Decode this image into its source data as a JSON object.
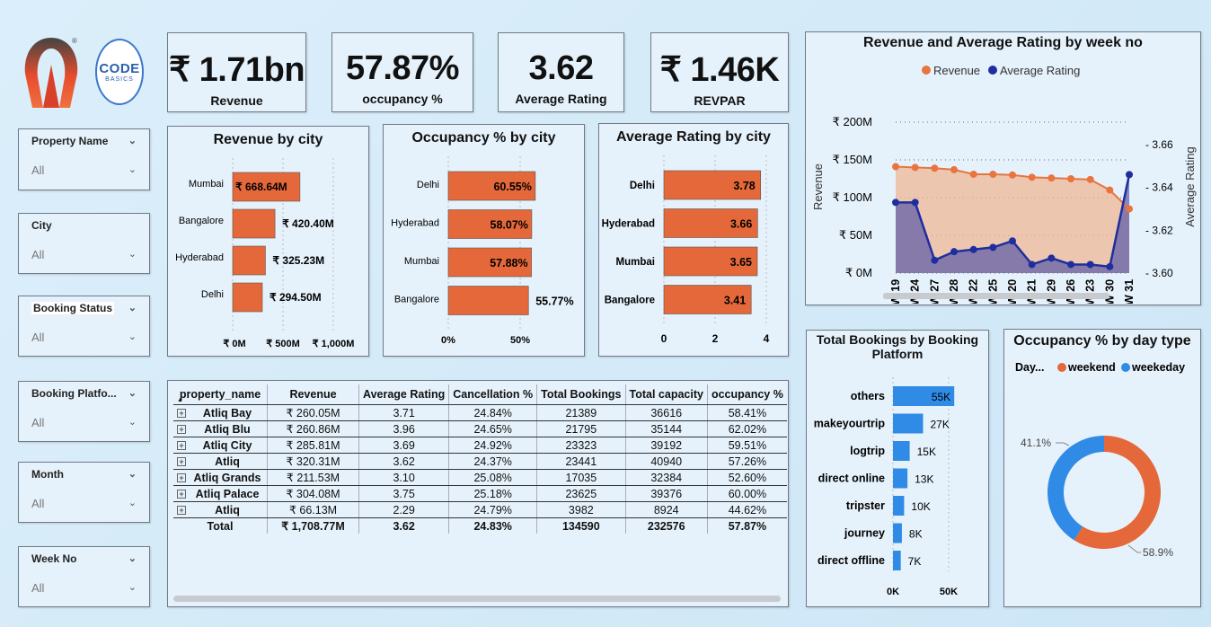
{
  "logos": {
    "code_main": "CODE",
    "code_sub": "BASICS",
    "registered": "®"
  },
  "kpis": [
    {
      "value": "₹ 1.71bn",
      "label": "Revenue"
    },
    {
      "value": "57.87%",
      "label": "occupancy %"
    },
    {
      "value": "3.62",
      "label": "Average Rating"
    },
    {
      "value": "₹ 1.46K",
      "label": "REVPAR"
    }
  ],
  "slicers": [
    {
      "title": "Property Name",
      "value": "All"
    },
    {
      "title": "City",
      "value": "All"
    },
    {
      "title": "Booking Status",
      "value": "All"
    },
    {
      "title": "Booking Platfo...",
      "value": "All"
    },
    {
      "title": "Month",
      "value": "All"
    },
    {
      "title": "Week No",
      "value": "All"
    }
  ],
  "revenue_by_city": {
    "title": "Revenue by city",
    "labels": [
      "Mumbai",
      "Bangalore",
      "Hyderabad",
      "Delhi"
    ],
    "values": [
      668.64,
      420.4,
      325.23,
      294.5
    ],
    "data_labels": [
      "₹ 668.64M",
      "₹ 420.40M",
      "₹ 325.23M",
      "₹ 294.50M"
    ],
    "ticks": [
      "₹ 0M",
      "₹ 500M",
      "₹ 1,000M"
    ]
  },
  "occupancy_by_city": {
    "title": "Occupancy % by city",
    "labels": [
      "Delhi",
      "Hyderabad",
      "Mumbai",
      "Bangalore"
    ],
    "values": [
      60.55,
      58.07,
      57.88,
      55.77
    ],
    "data_labels": [
      "60.55%",
      "58.07%",
      "57.88%",
      "55.77%"
    ],
    "ticks": [
      "0%",
      "50%"
    ]
  },
  "rating_by_city": {
    "title": "Average Rating by city",
    "labels": [
      "Delhi",
      "Hyderabad",
      "Mumbai",
      "Bangalore"
    ],
    "values": [
      3.78,
      3.66,
      3.65,
      3.41
    ],
    "data_labels": [
      "3.78",
      "3.66",
      "3.65",
      "3.41"
    ],
    "ticks": [
      "0",
      "2",
      "4"
    ]
  },
  "chart_data": [
    {
      "type": "area",
      "title": "Revenue and Average Rating by week no",
      "legend": [
        "Revenue",
        "Average Rating"
      ],
      "legend_position": "top",
      "ylabel": "Revenue",
      "y2label": "Average Rating",
      "categories": [
        "W 19",
        "W 24",
        "W 27",
        "W 28",
        "W 22",
        "W 25",
        "W 20",
        "W 21",
        "W 29",
        "W 26",
        "W 23",
        "W 30",
        "W 31"
      ],
      "series": [
        {
          "name": "Revenue",
          "axis": "left",
          "values": [
            141,
            140,
            139,
            137,
            131,
            131,
            130,
            127,
            126,
            125,
            124,
            110,
            85
          ]
        },
        {
          "name": "Average Rating",
          "axis": "right",
          "values": [
            3.633,
            3.633,
            3.606,
            3.61,
            3.611,
            3.612,
            3.615,
            3.604,
            3.607,
            3.604,
            3.604,
            3.603,
            3.646
          ]
        }
      ],
      "y_ticks": [
        "₹ 0M",
        "₹ 50M",
        "₹ 100M",
        "₹ 150M",
        "₹ 200M"
      ],
      "y2_ticks": [
        "3.60",
        "3.62",
        "3.64",
        "3.66"
      ],
      "ylim": [
        0,
        200
      ],
      "y2lim": [
        3.6,
        3.66
      ]
    },
    {
      "type": "bar",
      "title": "Total Bookings by Booking Platform",
      "categories": [
        "others",
        "makeyourtrip",
        "logtrip",
        "direct online",
        "tripster",
        "journey",
        "direct offline"
      ],
      "values": [
        55,
        27,
        15,
        13,
        10,
        8,
        7
      ],
      "data_labels": [
        "55K",
        "27K",
        "15K",
        "13K",
        "10K",
        "8K",
        "7K"
      ],
      "ticks": [
        "0K",
        "50K"
      ],
      "xlim": [
        0,
        60
      ]
    },
    {
      "type": "pie",
      "title": "Occupancy % by day type",
      "legend_title": "Day...",
      "categories": [
        "weekend",
        "weekeday"
      ],
      "values": [
        58.9,
        41.1
      ],
      "data_labels": [
        "58.9%",
        "41.1%"
      ]
    }
  ],
  "table": {
    "headers": [
      "property_name",
      "Revenue",
      "Average Rating",
      "Cancellation %",
      "Total Bookings",
      "Total capacity",
      "occupancy %"
    ],
    "rows": [
      [
        "Atliq Bay",
        "₹ 260.05M",
        "3.71",
        "24.84%",
        "21389",
        "36616",
        "58.41%"
      ],
      [
        "Atliq Blu",
        "₹ 260.86M",
        "3.96",
        "24.65%",
        "21795",
        "35144",
        "62.02%"
      ],
      [
        "Atliq City",
        "₹ 285.81M",
        "3.69",
        "24.92%",
        "23323",
        "39192",
        "59.51%"
      ],
      [
        "Atliq",
        "₹ 320.31M",
        "3.62",
        "24.37%",
        "23441",
        "40940",
        "57.26%"
      ],
      [
        "Atliq Grands",
        "₹ 211.53M",
        "3.10",
        "25.08%",
        "17035",
        "32384",
        "52.60%"
      ],
      [
        "Atliq Palace",
        "₹ 304.08M",
        "3.75",
        "25.18%",
        "23625",
        "39376",
        "60.00%"
      ],
      [
        "Atliq",
        "₹ 66.13M",
        "2.29",
        "24.79%",
        "3982",
        "8924",
        "44.62%"
      ]
    ],
    "total": [
      "Total",
      "₹ 1,708.77M",
      "3.62",
      "24.83%",
      "134590",
      "232576",
      "57.87%"
    ]
  },
  "colors": {
    "orange": "#e5683a",
    "navy": "#1f2e9e",
    "blue": "#2f8be6",
    "revenue_line": "#e8743f"
  },
  "icons": {
    "expand": "plus-box-icon",
    "sort": "sort-up-icon",
    "dropdown": "chevron-down-icon"
  }
}
